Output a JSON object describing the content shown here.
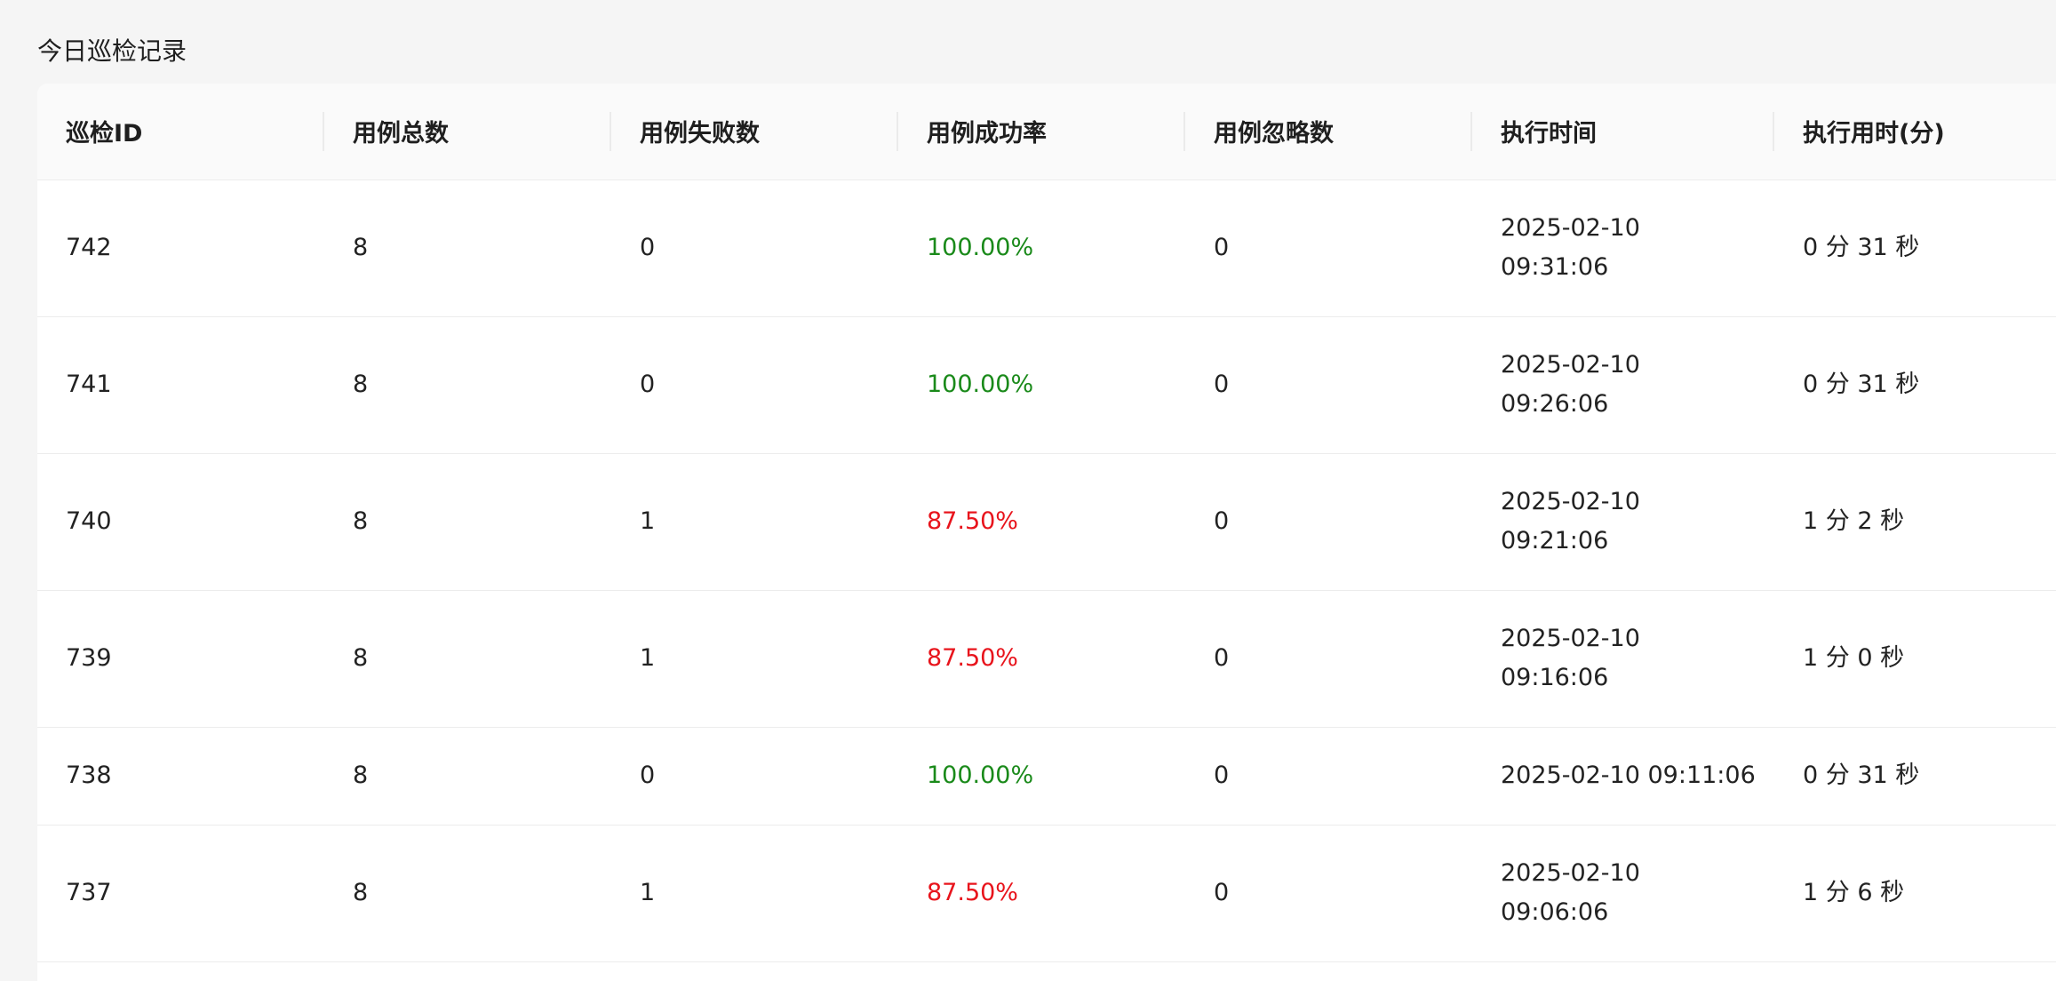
{
  "title": "今日巡检记录",
  "colors": {
    "success": "#1a8a1a",
    "fail": "#e8141c"
  },
  "columns": [
    "巡检ID",
    "用例总数",
    "用例失败数",
    "用例成功率",
    "用例忽略数",
    "执行时间",
    "执行用时(分)"
  ],
  "rows": [
    {
      "id": "742",
      "total": "8",
      "failed": "0",
      "rate": "100.00%",
      "rate_status": "success",
      "ignored": "0",
      "time_date": "2025-02-10",
      "time_clock": "09:31:06",
      "duration": "0 分 31 秒"
    },
    {
      "id": "741",
      "total": "8",
      "failed": "0",
      "rate": "100.00%",
      "rate_status": "success",
      "ignored": "0",
      "time_date": "2025-02-10",
      "time_clock": "09:26:06",
      "duration": "0 分 31 秒"
    },
    {
      "id": "740",
      "total": "8",
      "failed": "1",
      "rate": "87.50%",
      "rate_status": "fail",
      "ignored": "0",
      "time_date": "2025-02-10",
      "time_clock": "09:21:06",
      "duration": "1 分 2 秒"
    },
    {
      "id": "739",
      "total": "8",
      "failed": "1",
      "rate": "87.50%",
      "rate_status": "fail",
      "ignored": "0",
      "time_date": "2025-02-10",
      "time_clock": "09:16:06",
      "duration": "1 分 0 秒"
    },
    {
      "id": "738",
      "total": "8",
      "failed": "0",
      "rate": "100.00%",
      "rate_status": "success",
      "ignored": "0",
      "time_full": "2025-02-10 09:11:06",
      "duration": "0 分 31 秒"
    },
    {
      "id": "737",
      "total": "8",
      "failed": "1",
      "rate": "87.50%",
      "rate_status": "fail",
      "ignored": "0",
      "time_date": "2025-02-10",
      "time_clock": "09:06:06",
      "duration": "1 分 6 秒"
    }
  ]
}
